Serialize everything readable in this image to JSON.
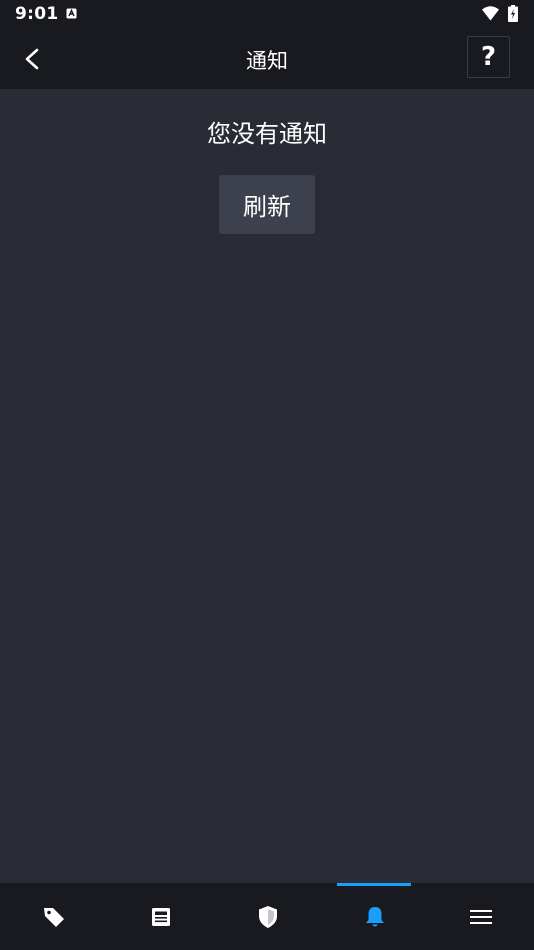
{
  "status_bar": {
    "time": "9:01",
    "icons": [
      "notification-icon",
      "wifi-icon",
      "battery-charging-icon"
    ]
  },
  "app_bar": {
    "title": "通知",
    "back_icon": "chevron-left-icon",
    "help_label": "?"
  },
  "main": {
    "empty_message": "您没有通知",
    "refresh_label": "刷新"
  },
  "bottom_nav": {
    "items": [
      {
        "icon": "tag-icon",
        "active": false
      },
      {
        "icon": "news-icon",
        "active": false
      },
      {
        "icon": "shield-icon",
        "active": false
      },
      {
        "icon": "bell-icon",
        "active": true
      },
      {
        "icon": "menu-icon",
        "active": false
      }
    ],
    "active_color": "#1a9fff",
    "inactive_color": "#ffffff"
  },
  "colors": {
    "background": "#292c35",
    "bar_background": "#181a20",
    "button_background": "#3d414d",
    "accent": "#1a9fff"
  }
}
